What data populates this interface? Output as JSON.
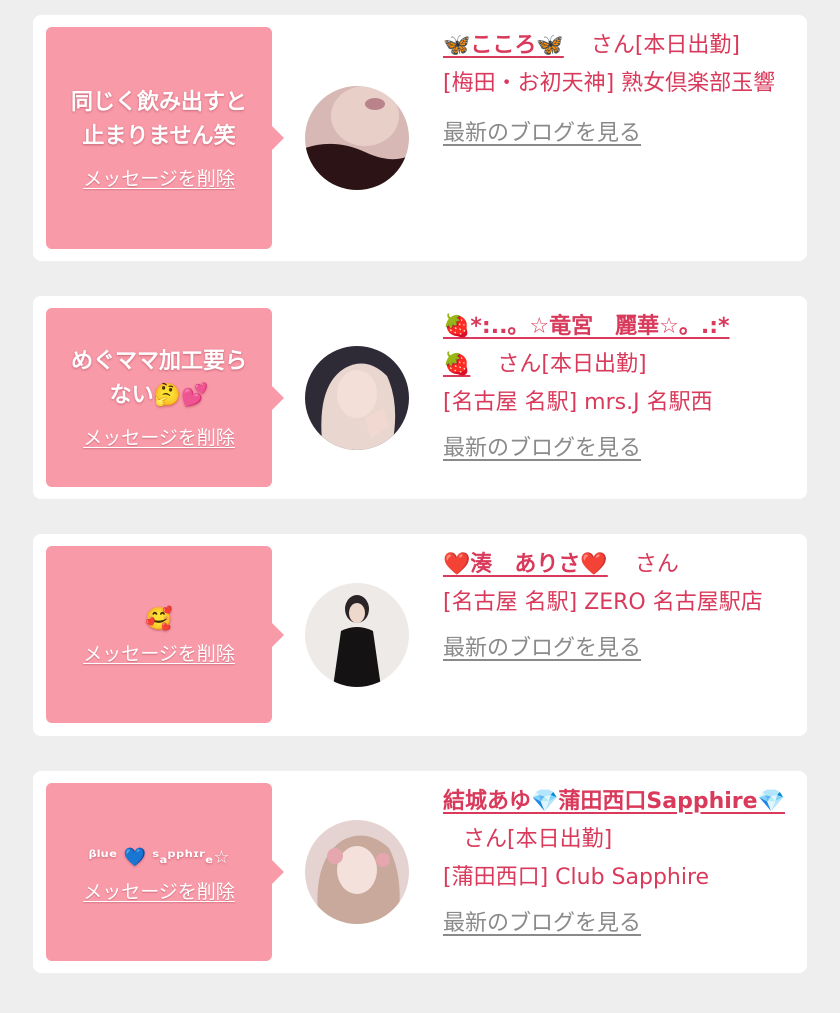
{
  "common": {
    "delete_label": "メッセージを削除",
    "blog_label": "最新のブログを見る",
    "san": "さん"
  },
  "cards": [
    {
      "message": "同じく飲み出すと\n止まりません笑",
      "name_prefix": "🦋",
      "name": "こころ",
      "name_suffix": "🦋",
      "status": "[本日出勤]",
      "area": "[梅田・お初天神]",
      "shop": "熟女倶楽部玉響",
      "avatar_icon": "avatar-photo"
    },
    {
      "message": "めぐママ加工要ら\nない🤔💕",
      "name_prefix": "🍓",
      "name": "*:..。☆竜宮　麗華☆。.:*",
      "name_suffix": "🍓",
      "status": "[本日出勤]",
      "area": "[名古屋 名駅]",
      "shop": "mrs.J 名駅西",
      "avatar_icon": "avatar-photo"
    },
    {
      "message": "🥰",
      "name_prefix": "❤️",
      "name": "湊　ありさ",
      "name_suffix": "❤️",
      "status": "",
      "area": "[名古屋 名駅]",
      "shop": "ZERO 名古屋駅店",
      "avatar_icon": "avatar-photo"
    },
    {
      "message": "ᵝˡᵘᵉ 💙 ˢₐᵖᵖʰᶦʳₑ☆",
      "name_prefix": "",
      "name": "結城あゆ💎蒲田西口Sapphire💎",
      "name_suffix": "",
      "status": "[本日出勤]",
      "area": "[蒲田西口]",
      "shop": "Club Sapphire",
      "avatar_icon": "avatar-photo"
    }
  ]
}
